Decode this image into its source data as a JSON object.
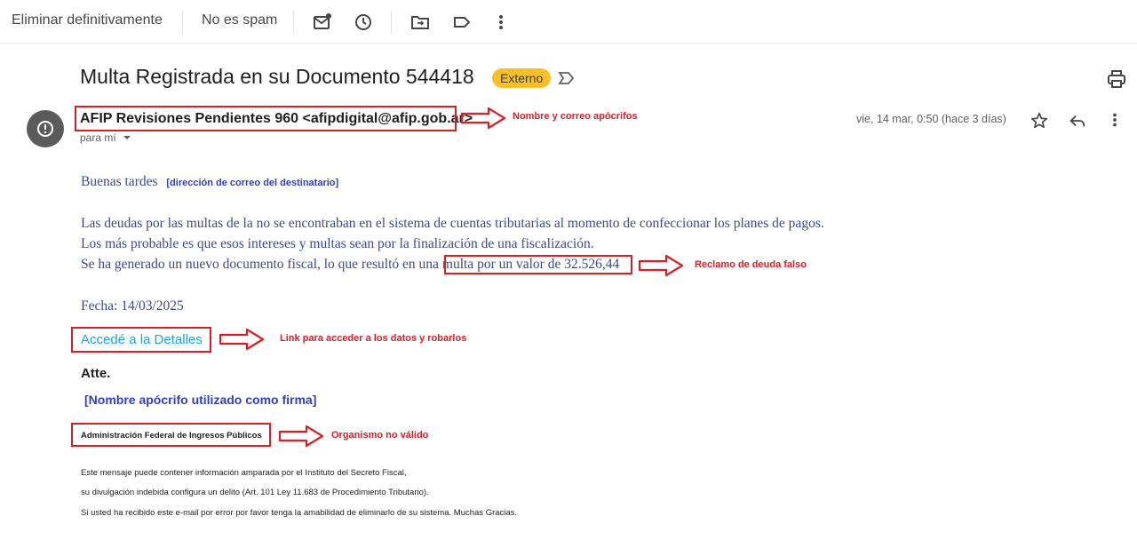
{
  "toolbar": {
    "delete_forever_label": "Eliminar definitivamente",
    "not_spam_label": "No es spam"
  },
  "email": {
    "subject": "Multa Registrada en su Documento 544418",
    "external_badge": "Externo",
    "sender": "AFIP Revisiones Pendientes 960 <afipdigital@afip.gob.ar>",
    "recipient_label": "para mí",
    "date": "vie, 14 mar, 0:50 (hace 3 días)",
    "greeting": "Buenas tardes",
    "recipient_placeholder": "[dirección de correo del destinatario]",
    "body_line1": "Las deudas por las multas de la no se encontraban en el sistema de cuentas tributarias al momento de confeccionar los planes de pagos.",
    "body_line2": "Los más probable es que esos intereses y multas sean por la finalización de una fiscalización.",
    "body_line3_prefix": "Se ha generado un nuevo documento fiscal, lo que resultó en una",
    "body_line3_highlight": "multa por un valor de 32.526,44",
    "date_line": "Fecha: 14/03/2025",
    "link_text": "Accedé a la Detalles",
    "closing": "Atte.",
    "signature_placeholder": "[Nombre apócrifo utilizado como firma]",
    "organization": "Administración Federal de Ingresos Públicos",
    "footer_line1": "Este mensaje puede contener información amparada por el Instituto del Secreto Fiscal,",
    "footer_line2": "su divulgación indebida configura un delito (Art. 101 Ley 11.683 de Procedimiento Tributario).",
    "footer_line3": "Si usted ha recibido este e-mail por error por favor tenga la amabilidad de eliminarlo de su sistema. Muchas Gracias."
  },
  "annotations": {
    "sender": "Nombre y correo apócrifos",
    "debt": "Reclamo de deuda falso",
    "link": "Link para acceder a los datos y robarlos",
    "organization": "Organismo no válido"
  },
  "colors": {
    "annotation_red": "#d71f26",
    "badge_yellow": "#f6c026",
    "body_blue": "#3b4a8c",
    "link_blue": "#1aa3e0",
    "signature_blue": "#2f3fc4"
  },
  "icons": [
    "mark-unread-icon",
    "snooze-icon",
    "move-to-icon",
    "label-icon",
    "more-vert-icon",
    "importance-icon",
    "print-icon",
    "warning-avatar-icon",
    "star-icon",
    "reply-icon",
    "more-vert-icon",
    "dropdown-icon",
    "arrow-icon"
  ]
}
